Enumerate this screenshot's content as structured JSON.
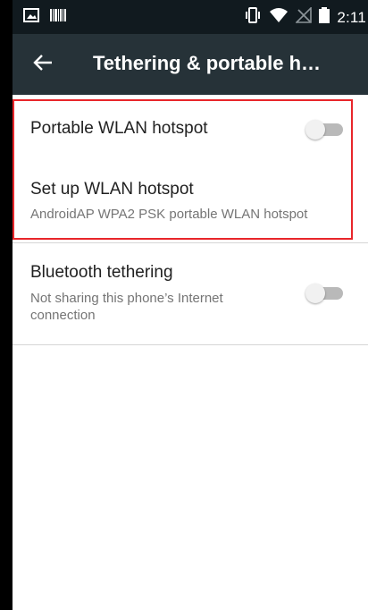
{
  "status_bar": {
    "time": "2:11",
    "icons": [
      "image-notification-icon",
      "barcode-notification-icon",
      "vibrate-icon",
      "wifi-icon",
      "no-signal-icon",
      "battery-icon"
    ]
  },
  "app_bar": {
    "title": "Tethering & portable h…",
    "back_icon": "arrow-back-icon"
  },
  "settings": {
    "portable_hotspot": {
      "title": "Portable WLAN hotspot",
      "enabled": false
    },
    "setup_hotspot": {
      "title": "Set up WLAN hotspot",
      "summary": "AndroidAP WPA2 PSK portable WLAN hotspot"
    },
    "bluetooth_tethering": {
      "title": "Bluetooth tethering",
      "summary_line1": "Not sharing this phone’s Internet",
      "summary_line2": "connection",
      "enabled": false
    }
  },
  "colors": {
    "status_bar": "#111a1f",
    "app_bar": "#263238",
    "highlight": "#e8262b",
    "switch_track_off": "#b9b9b9",
    "switch_thumb_off": "#f1f1f1"
  }
}
